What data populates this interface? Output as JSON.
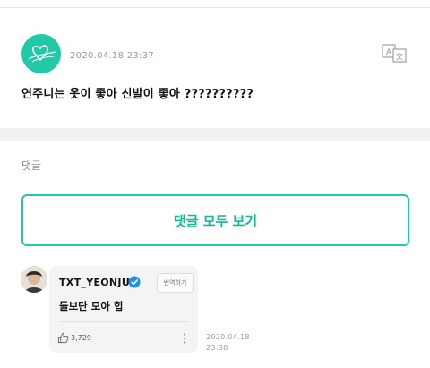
{
  "post": {
    "timestamp": "2020.04.18  23:37",
    "body": "연주니는 옷이 좋아 신발이 좋아 ??????????",
    "translate_icon": "translate-icon",
    "author_avatar": "weverse-heart-logo"
  },
  "comments": {
    "section_label": "댓글",
    "view_all_label": "댓글 모두 보기",
    "items": [
      {
        "author": "TXT_YEONJUN",
        "verified": true,
        "translate_label": "번역하기",
        "text": "둘보단 모아 힙",
        "likes": "3,729",
        "timestamp_date": "2020.04.18",
        "timestamp_time": "23:38"
      }
    ]
  },
  "colors": {
    "accent": "#22c9a5",
    "accent_text": "#14b894",
    "verified": "#1f8ee6"
  }
}
